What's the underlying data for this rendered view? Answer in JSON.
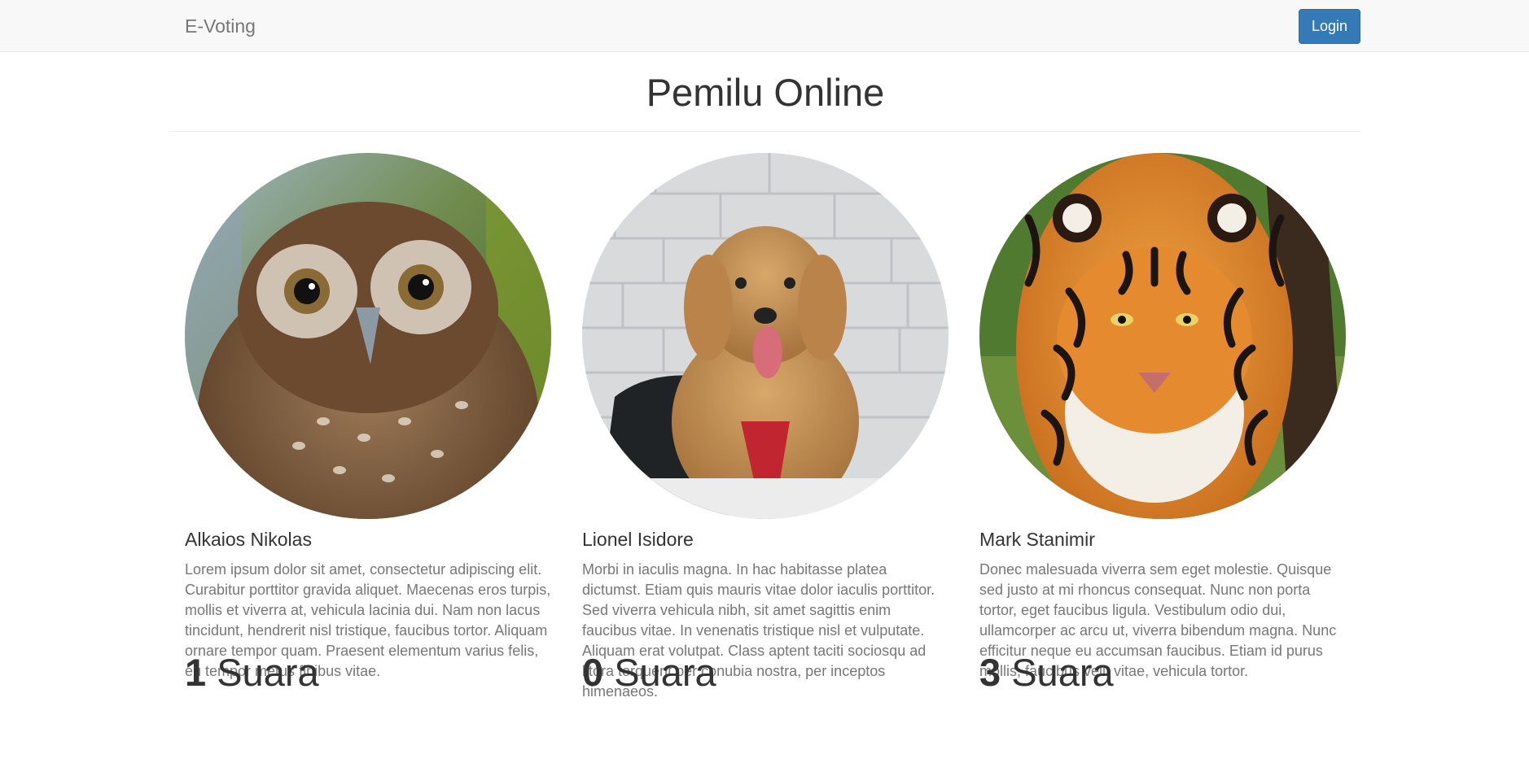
{
  "navbar": {
    "brand": "E-Voting",
    "login_label": "Login"
  },
  "page_title": "Pemilu Online",
  "candidates": [
    {
      "name": "Alkaios Nikolas",
      "description": "Lorem ipsum dolor sit amet, consectetur adipiscing elit. Curabitur porttitor gravida aliquet. Maecenas eros turpis, mollis et viverra at, vehicula lacinia dui. Nam non lacus tincidunt, hendrerit nisl tristique, faucibus tortor. Aliquam ornare tempor quam. Praesent elementum varius felis, eu tempor metus finibus vitae.",
      "vote_count": "1",
      "vote_label": "Suara",
      "photo": "owl-photo"
    },
    {
      "name": "Lionel Isidore",
      "description": "Morbi in iaculis magna. In hac habitasse platea dictumst. Etiam quis mauris vitae dolor iaculis porttitor. Sed viverra vehicula nibh, sit amet sagittis enim faucibus vitae. In venenatis tristique nisl et vulputate. Aliquam erat volutpat. Class aptent taciti sociosqu ad litora torquent per conubia nostra, per inceptos himenaeos.",
      "vote_count": "0",
      "vote_label": "Suara",
      "photo": "dog-photo"
    },
    {
      "name": "Mark Stanimir",
      "description": "Donec malesuada viverra sem eget molestie. Quisque sed justo at mi rhoncus consequat. Nunc non porta tortor, eget faucibus ligula. Vestibulum odio dui, ullamcorper ac arcu ut, viverra bibendum magna. Nunc efficitur neque eu accumsan faucibus. Etiam id purus mollis, faucibus velit vitae, vehicula tortor.",
      "vote_count": "3",
      "vote_label": "Suara",
      "photo": "tiger-photo"
    }
  ],
  "colors": {
    "primary": "#337ab7",
    "navbar_bg": "#f8f8f8",
    "muted_text": "#777777",
    "text": "#333333"
  }
}
